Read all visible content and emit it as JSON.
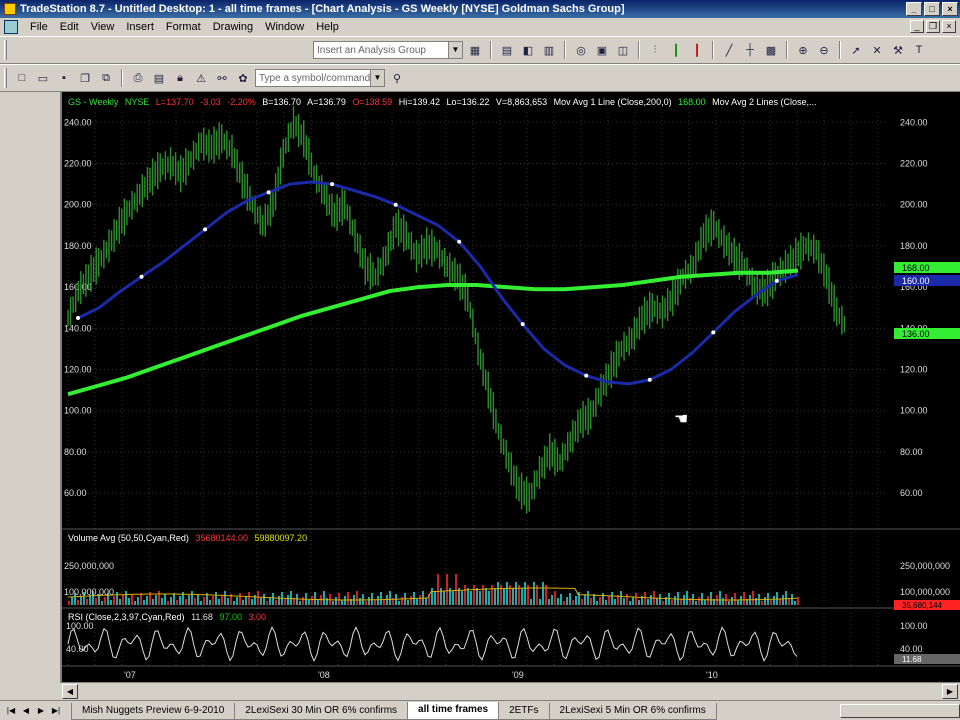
{
  "window": {
    "title": "TradeStation 8.7 - Untitled Desktop: 1 - all time frames - [Chart Analysis - GS Weekly [NYSE] Goldman Sachs Group]"
  },
  "menu": [
    "File",
    "Edit",
    "View",
    "Insert",
    "Format",
    "Drawing",
    "Window",
    "Help"
  ],
  "toolbar": {
    "analysis_group_placeholder": "Insert an Analysis Group",
    "symbol_placeholder": "Type a symbol/command"
  },
  "chart": {
    "header": {
      "symbol": "GS - Weekly",
      "exchange": "NYSE",
      "last": "L=137.70",
      "change": "-3.03",
      "change_pct": "-2.20%",
      "bid": "B=136.70",
      "ask": "A=136.79",
      "open": "O=138.59",
      "high": "Hi=139.42",
      "low": "Lo=136.22",
      "volume": "V=8,863,653",
      "ma1_label": "Mov Avg 1 Line (Close,200,0)",
      "ma1_value": "168.00",
      "ma2_label": "Mov Avg 2 Lines (Close,..."
    },
    "volume_label": "Volume Avg (50,50,Cyan,Red)",
    "volume_value1": "35680144.00",
    "volume_value2": "59880097.20",
    "rsi_label": "RSI (Close,2,3,97,Cyan,Red)",
    "rsi_value1": "11.68",
    "rsi_value2": "97.00",
    "rsi_value3": "3.00",
    "price_right_badges": [
      "168.00",
      "160.00",
      "136.00"
    ],
    "volume_badge": "35,680,144",
    "rsi_badge": "11.68"
  },
  "chart_data": {
    "type": "line",
    "price_ylim": [
      45,
      245
    ],
    "price_ticks": [
      "240.00",
      "220.00",
      "200.00",
      "180.00",
      "160.00",
      "140.00",
      "120.00",
      "100.00",
      "80.00",
      "60.00"
    ],
    "x_labels": [
      "'07",
      "'08",
      "'09",
      "'10"
    ],
    "price_close": [
      145,
      158,
      165,
      172,
      180,
      190,
      198,
      205,
      212,
      218,
      220,
      215,
      222,
      230,
      228,
      232,
      226,
      212,
      200,
      190,
      200,
      225,
      240,
      232,
      215,
      205,
      195,
      200,
      185,
      170,
      165,
      175,
      190,
      185,
      175,
      180,
      178,
      170,
      165,
      155,
      130,
      110,
      90,
      75,
      62,
      58,
      70,
      80,
      75,
      85,
      95,
      98,
      110,
      120,
      130,
      135,
      145,
      150,
      148,
      155,
      165,
      170,
      185,
      190,
      182,
      175,
      170,
      160,
      158,
      165,
      170,
      175,
      180,
      178,
      165,
      148,
      140
    ],
    "ma_blue": [
      145,
      150,
      158,
      165,
      172,
      180,
      188,
      196,
      202,
      206,
      210,
      211,
      210,
      207,
      204,
      200,
      195,
      190,
      182,
      170,
      155,
      142,
      130,
      122,
      117,
      114,
      113,
      115,
      120,
      128,
      138,
      148,
      156,
      163,
      166
    ],
    "ma_green": [
      108,
      112,
      116,
      121,
      126,
      131,
      136,
      141,
      146,
      150,
      154,
      158,
      160,
      161,
      161,
      160,
      159,
      159,
      160,
      161,
      163,
      165,
      166,
      167,
      167,
      168
    ],
    "volume_ticks": [
      "250,000,000",
      "100,000,000"
    ],
    "rsi_ticks": [
      "100.00",
      "40.00"
    ]
  },
  "tabs": [
    {
      "label": "Mish Nuggets Preview 6-9-2010",
      "active": false
    },
    {
      "label": "2LexiSexi 30 Min OR 6% confirms",
      "active": false
    },
    {
      "label": "all time frames",
      "active": true
    },
    {
      "label": "2ETFs",
      "active": false
    },
    {
      "label": "2LexiSexi 5 Min OR 6% confirms",
      "active": false
    }
  ],
  "colors": {
    "price": "#2f8f2f",
    "ma_blue": "#1a2aa8",
    "ma_green": "#33ee33",
    "rsi": "#dddddd",
    "grid": "#333333"
  }
}
